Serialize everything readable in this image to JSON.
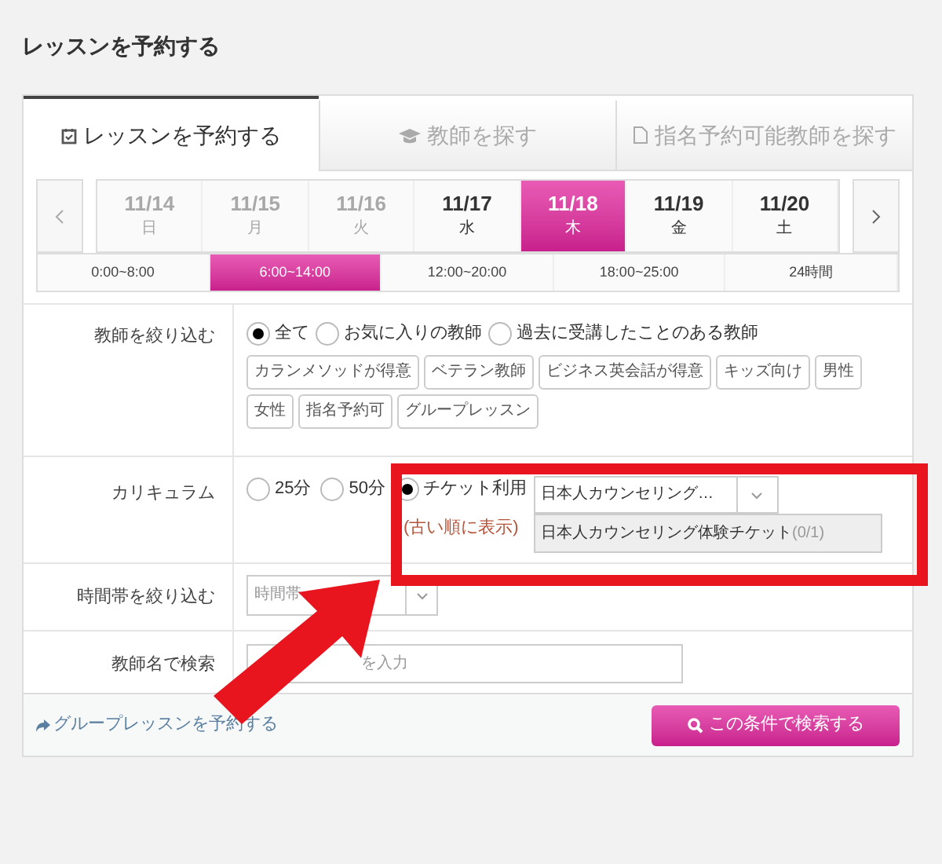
{
  "page_title": "レッスンを予約する",
  "tabs": [
    {
      "label": "レッスンを予約する",
      "selected": true
    },
    {
      "label": "教師を探す",
      "selected": false
    },
    {
      "label": "指名予約可能教師を探す",
      "selected": false
    }
  ],
  "dates": [
    {
      "date": "11/14",
      "weekday": "日",
      "disabled": true,
      "selected": false
    },
    {
      "date": "11/15",
      "weekday": "月",
      "disabled": true,
      "selected": false
    },
    {
      "date": "11/16",
      "weekday": "火",
      "disabled": true,
      "selected": false
    },
    {
      "date": "11/17",
      "weekday": "水",
      "disabled": false,
      "selected": false
    },
    {
      "date": "11/18",
      "weekday": "木",
      "disabled": false,
      "selected": true
    },
    {
      "date": "11/19",
      "weekday": "金",
      "disabled": false,
      "selected": false
    },
    {
      "date": "11/20",
      "weekday": "土",
      "disabled": false,
      "selected": false
    }
  ],
  "time_ranges": [
    {
      "label": "0:00~8:00",
      "selected": false
    },
    {
      "label": "6:00~14:00",
      "selected": true
    },
    {
      "label": "12:00~20:00",
      "selected": false
    },
    {
      "label": "18:00~25:00",
      "selected": false
    },
    {
      "label": "24時間",
      "selected": false
    }
  ],
  "teacher_filter": {
    "label": "教師を絞り込む",
    "options": [
      {
        "label": "全て",
        "selected": true
      },
      {
        "label": "お気に入りの教師",
        "selected": false
      },
      {
        "label": "過去に受講したことのある教師",
        "selected": false
      }
    ],
    "tags": [
      "カランメソッドが得意",
      "ベテラン教師",
      "ビジネス英会話が得意",
      "キッズ向け",
      "男性",
      "女性",
      "指名予約可",
      "グループレッスン"
    ]
  },
  "curriculum": {
    "label": "カリキュラム",
    "options": [
      {
        "label": "25分",
        "selected": false
      },
      {
        "label": "50分",
        "selected": false
      },
      {
        "label": "チケット利用",
        "selected": true
      }
    ],
    "note": "(古い順に表示)",
    "select_value": "日本人カウンセリング…",
    "dropdown_item": "日本人カウンセリング体験チケット",
    "dropdown_count": "(0/1)"
  },
  "time_filter": {
    "label": "時間帯を絞り込む",
    "placeholder": "時間帯"
  },
  "name_search": {
    "label": "教師名で検索",
    "placeholder": "を入力"
  },
  "group_link": "グループレッスンを予約する",
  "search_button": "この条件で検索する"
}
